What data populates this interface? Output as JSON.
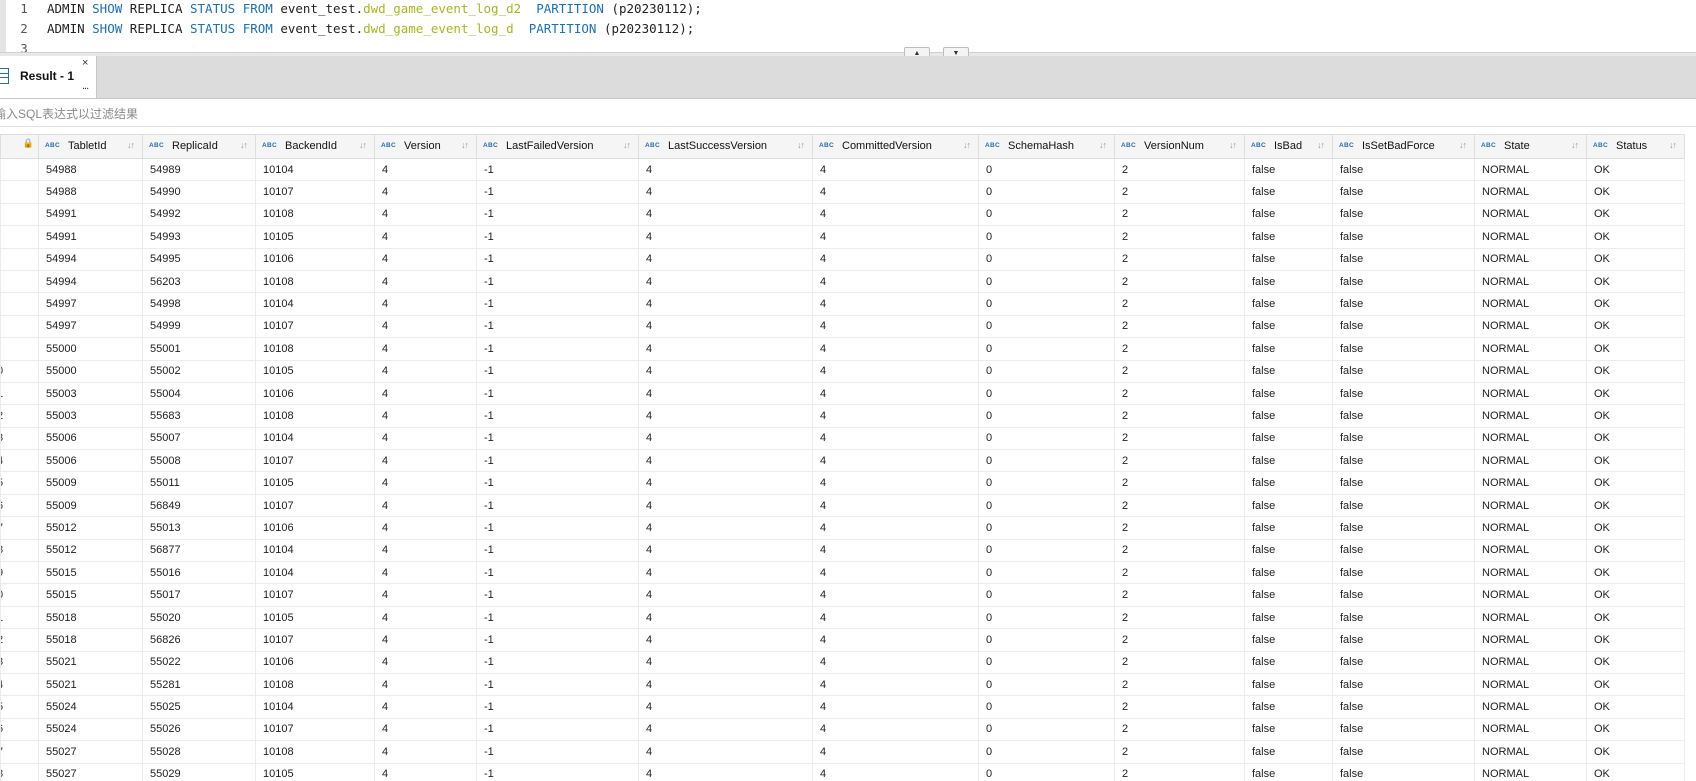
{
  "editor": {
    "lines": [
      {
        "num": "1",
        "parts": [
          [
            "ADMIN ",
            ""
          ],
          [
            "SHOW",
            "kw"
          ],
          [
            " REPLICA ",
            ""
          ],
          [
            "STATUS",
            "kw"
          ],
          [
            " ",
            ""
          ],
          [
            "FROM",
            "kw"
          ],
          [
            " event_test.",
            ""
          ],
          [
            "dwd_game_event_log_d2",
            "tbl"
          ],
          [
            "  ",
            ""
          ],
          [
            "PARTITION",
            "kw"
          ],
          [
            " (p20230112);",
            ""
          ]
        ]
      },
      {
        "num": "2",
        "parts": [
          [
            "ADMIN ",
            ""
          ],
          [
            "SHOW",
            "kw"
          ],
          [
            " REPLICA ",
            ""
          ],
          [
            "STATUS",
            "kw"
          ],
          [
            " ",
            ""
          ],
          [
            "FROM",
            "kw"
          ],
          [
            " event_test.",
            ""
          ],
          [
            "dwd_game_event_log_d",
            "tbl"
          ],
          [
            "  ",
            ""
          ],
          [
            "PARTITION",
            "kw"
          ],
          [
            " (p20230112);",
            ""
          ]
        ]
      },
      {
        "num": "3",
        "parts": []
      }
    ]
  },
  "splitter": {
    "up": "▲",
    "down": "▼"
  },
  "results": {
    "tab_label": "Result - 1",
    "tab_close": "×",
    "tab_more": "...",
    "filter_placeholder": "输入SQL表达式以过滤结果"
  },
  "grid": {
    "type_badge": "ABC",
    "sort_icon": "↓↑",
    "lock_icon": "🔒",
    "columns": [
      "TabletId",
      "ReplicaId",
      "BackendId",
      "Version",
      "LastFailedVersion",
      "LastSuccessVersion",
      "CommittedVersion",
      "SchemaHash",
      "VersionNum",
      "IsBad",
      "IsSetBadForce",
      "State",
      "Status"
    ],
    "rows": [
      [
        "",
        "54988",
        "54989",
        "10104",
        "4",
        "-1",
        "4",
        "4",
        "0",
        "2",
        "false",
        "false",
        "NORMAL",
        "OK"
      ],
      [
        "",
        "54988",
        "54990",
        "10107",
        "4",
        "-1",
        "4",
        "4",
        "0",
        "2",
        "false",
        "false",
        "NORMAL",
        "OK"
      ],
      [
        "",
        "54991",
        "54992",
        "10108",
        "4",
        "-1",
        "4",
        "4",
        "0",
        "2",
        "false",
        "false",
        "NORMAL",
        "OK"
      ],
      [
        "",
        "54991",
        "54993",
        "10105",
        "4",
        "-1",
        "4",
        "4",
        "0",
        "2",
        "false",
        "false",
        "NORMAL",
        "OK"
      ],
      [
        "",
        "54994",
        "54995",
        "10106",
        "4",
        "-1",
        "4",
        "4",
        "0",
        "2",
        "false",
        "false",
        "NORMAL",
        "OK"
      ],
      [
        "",
        "54994",
        "56203",
        "10108",
        "4",
        "-1",
        "4",
        "4",
        "0",
        "2",
        "false",
        "false",
        "NORMAL",
        "OK"
      ],
      [
        "",
        "54997",
        "54998",
        "10104",
        "4",
        "-1",
        "4",
        "4",
        "0",
        "2",
        "false",
        "false",
        "NORMAL",
        "OK"
      ],
      [
        "",
        "54997",
        "54999",
        "10107",
        "4",
        "-1",
        "4",
        "4",
        "0",
        "2",
        "false",
        "false",
        "NORMAL",
        "OK"
      ],
      [
        "",
        "55000",
        "55001",
        "10108",
        "4",
        "-1",
        "4",
        "4",
        "0",
        "2",
        "false",
        "false",
        "NORMAL",
        "OK"
      ],
      [
        "0",
        "55000",
        "55002",
        "10105",
        "4",
        "-1",
        "4",
        "4",
        "0",
        "2",
        "false",
        "false",
        "NORMAL",
        "OK"
      ],
      [
        "1",
        "55003",
        "55004",
        "10106",
        "4",
        "-1",
        "4",
        "4",
        "0",
        "2",
        "false",
        "false",
        "NORMAL",
        "OK"
      ],
      [
        "2",
        "55003",
        "55683",
        "10108",
        "4",
        "-1",
        "4",
        "4",
        "0",
        "2",
        "false",
        "false",
        "NORMAL",
        "OK"
      ],
      [
        "3",
        "55006",
        "55007",
        "10104",
        "4",
        "-1",
        "4",
        "4",
        "0",
        "2",
        "false",
        "false",
        "NORMAL",
        "OK"
      ],
      [
        "4",
        "55006",
        "55008",
        "10107",
        "4",
        "-1",
        "4",
        "4",
        "0",
        "2",
        "false",
        "false",
        "NORMAL",
        "OK"
      ],
      [
        "5",
        "55009",
        "55011",
        "10105",
        "4",
        "-1",
        "4",
        "4",
        "0",
        "2",
        "false",
        "false",
        "NORMAL",
        "OK"
      ],
      [
        "6",
        "55009",
        "56849",
        "10107",
        "4",
        "-1",
        "4",
        "4",
        "0",
        "2",
        "false",
        "false",
        "NORMAL",
        "OK"
      ],
      [
        "7",
        "55012",
        "55013",
        "10106",
        "4",
        "-1",
        "4",
        "4",
        "0",
        "2",
        "false",
        "false",
        "NORMAL",
        "OK"
      ],
      [
        "8",
        "55012",
        "56877",
        "10104",
        "4",
        "-1",
        "4",
        "4",
        "0",
        "2",
        "false",
        "false",
        "NORMAL",
        "OK"
      ],
      [
        "9",
        "55015",
        "55016",
        "10104",
        "4",
        "-1",
        "4",
        "4",
        "0",
        "2",
        "false",
        "false",
        "NORMAL",
        "OK"
      ],
      [
        "0",
        "55015",
        "55017",
        "10107",
        "4",
        "-1",
        "4",
        "4",
        "0",
        "2",
        "false",
        "false",
        "NORMAL",
        "OK"
      ],
      [
        "1",
        "55018",
        "55020",
        "10105",
        "4",
        "-1",
        "4",
        "4",
        "0",
        "2",
        "false",
        "false",
        "NORMAL",
        "OK"
      ],
      [
        "2",
        "55018",
        "56826",
        "10107",
        "4",
        "-1",
        "4",
        "4",
        "0",
        "2",
        "false",
        "false",
        "NORMAL",
        "OK"
      ],
      [
        "3",
        "55021",
        "55022",
        "10106",
        "4",
        "-1",
        "4",
        "4",
        "0",
        "2",
        "false",
        "false",
        "NORMAL",
        "OK"
      ],
      [
        "4",
        "55021",
        "55281",
        "10108",
        "4",
        "-1",
        "4",
        "4",
        "0",
        "2",
        "false",
        "false",
        "NORMAL",
        "OK"
      ],
      [
        "5",
        "55024",
        "55025",
        "10104",
        "4",
        "-1",
        "4",
        "4",
        "0",
        "2",
        "false",
        "false",
        "NORMAL",
        "OK"
      ],
      [
        "6",
        "55024",
        "55026",
        "10107",
        "4",
        "-1",
        "4",
        "4",
        "0",
        "2",
        "false",
        "false",
        "NORMAL",
        "OK"
      ],
      [
        "7",
        "55027",
        "55028",
        "10108",
        "4",
        "-1",
        "4",
        "4",
        "0",
        "2",
        "false",
        "false",
        "NORMAL",
        "OK"
      ],
      [
        "8",
        "55027",
        "55029",
        "10105",
        "4",
        "-1",
        "4",
        "4",
        "0",
        "2",
        "false",
        "false",
        "NORMAL",
        "OK"
      ]
    ]
  }
}
